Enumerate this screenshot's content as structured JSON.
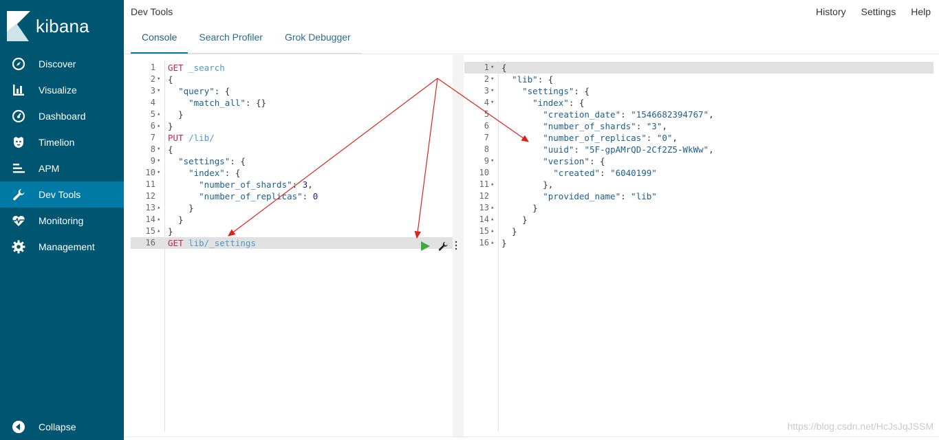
{
  "brand": {
    "logo_text": "kibana"
  },
  "sidebar": {
    "items": [
      {
        "label": "Discover",
        "icon": "compass-icon",
        "active": false
      },
      {
        "label": "Visualize",
        "icon": "bar-chart-icon",
        "active": false
      },
      {
        "label": "Dashboard",
        "icon": "dashboard-gauge-icon",
        "active": false
      },
      {
        "label": "Timelion",
        "icon": "timelion-icon",
        "active": false
      },
      {
        "label": "APM",
        "icon": "apm-icon",
        "active": false
      },
      {
        "label": "Dev Tools",
        "icon": "wrench-icon",
        "active": true
      },
      {
        "label": "Monitoring",
        "icon": "heartbeat-icon",
        "active": false
      },
      {
        "label": "Management",
        "icon": "gear-icon",
        "active": false
      }
    ],
    "collapse_label": "Collapse"
  },
  "header": {
    "title": "Dev Tools",
    "links": [
      "History",
      "Settings",
      "Help"
    ],
    "tabs": [
      {
        "label": "Console",
        "active": true
      },
      {
        "label": "Search Profiler",
        "active": false
      },
      {
        "label": "Grok Debugger",
        "active": false
      }
    ]
  },
  "request_editor": {
    "lines": [
      {
        "n": "1",
        "fold": "",
        "tokens": [
          [
            "m",
            "GET"
          ],
          [
            "t",
            " "
          ],
          [
            "u",
            "_search"
          ]
        ]
      },
      {
        "n": "2",
        "fold": "▾",
        "tokens": [
          [
            "t",
            "{"
          ]
        ]
      },
      {
        "n": "3",
        "fold": "▾",
        "tokens": [
          [
            "t",
            "  "
          ],
          [
            "k",
            "\"query\""
          ],
          [
            "t",
            ": {"
          ]
        ]
      },
      {
        "n": "4",
        "fold": "",
        "tokens": [
          [
            "t",
            "    "
          ],
          [
            "k",
            "\"match_all\""
          ],
          [
            "t",
            ": {}"
          ]
        ]
      },
      {
        "n": "5",
        "fold": "▴",
        "tokens": [
          [
            "t",
            "  }"
          ]
        ]
      },
      {
        "n": "6",
        "fold": "▴",
        "tokens": [
          [
            "t",
            "}"
          ]
        ]
      },
      {
        "n": "7",
        "fold": "",
        "tokens": [
          [
            "m",
            "PUT"
          ],
          [
            "t",
            " "
          ],
          [
            "u",
            "/lib/"
          ]
        ]
      },
      {
        "n": "8",
        "fold": "▾",
        "tokens": [
          [
            "t",
            "{"
          ]
        ]
      },
      {
        "n": "9",
        "fold": "▾",
        "tokens": [
          [
            "t",
            "  "
          ],
          [
            "k",
            "\"settings\""
          ],
          [
            "t",
            ": {"
          ]
        ]
      },
      {
        "n": "10",
        "fold": "▾",
        "tokens": [
          [
            "t",
            "    "
          ],
          [
            "k",
            "\"index\""
          ],
          [
            "t",
            ": {"
          ]
        ]
      },
      {
        "n": "11",
        "fold": "",
        "tokens": [
          [
            "t",
            "      "
          ],
          [
            "k",
            "\"number_of_shards\""
          ],
          [
            "t",
            ": "
          ],
          [
            "n",
            "3"
          ],
          [
            "t",
            ","
          ]
        ]
      },
      {
        "n": "12",
        "fold": "",
        "tokens": [
          [
            "t",
            "      "
          ],
          [
            "k",
            "\"number_of_replicas\""
          ],
          [
            "t",
            ": "
          ],
          [
            "n",
            "0"
          ]
        ]
      },
      {
        "n": "13",
        "fold": "▴",
        "tokens": [
          [
            "t",
            "    }"
          ]
        ]
      },
      {
        "n": "14",
        "fold": "▴",
        "tokens": [
          [
            "t",
            "  }"
          ]
        ]
      },
      {
        "n": "15",
        "fold": "▴",
        "tokens": [
          [
            "t",
            "}"
          ]
        ]
      },
      {
        "n": "16",
        "fold": "",
        "hl": true,
        "tokens": [
          [
            "m",
            "GET"
          ],
          [
            "t",
            " "
          ],
          [
            "u",
            "lib/_settings"
          ]
        ]
      }
    ]
  },
  "response_editor": {
    "lines": [
      {
        "n": "1",
        "fold": "▾",
        "hl": true,
        "tokens": [
          [
            "t",
            "{"
          ]
        ]
      },
      {
        "n": "2",
        "fold": "▾",
        "tokens": [
          [
            "t",
            "  "
          ],
          [
            "k",
            "\"lib\""
          ],
          [
            "t",
            ": {"
          ]
        ]
      },
      {
        "n": "3",
        "fold": "▾",
        "tokens": [
          [
            "t",
            "    "
          ],
          [
            "k",
            "\"settings\""
          ],
          [
            "t",
            ": {"
          ]
        ]
      },
      {
        "n": "4",
        "fold": "▾",
        "tokens": [
          [
            "t",
            "      "
          ],
          [
            "k",
            "\"index\""
          ],
          [
            "t",
            ": {"
          ]
        ]
      },
      {
        "n": "5",
        "fold": "",
        "tokens": [
          [
            "t",
            "        "
          ],
          [
            "k",
            "\"creation_date\""
          ],
          [
            "t",
            ": "
          ],
          [
            "s",
            "\"1546682394767\""
          ],
          [
            "t",
            ","
          ]
        ]
      },
      {
        "n": "6",
        "fold": "",
        "tokens": [
          [
            "t",
            "        "
          ],
          [
            "k",
            "\"number_of_shards\""
          ],
          [
            "t",
            ": "
          ],
          [
            "s",
            "\"3\""
          ],
          [
            "t",
            ","
          ]
        ]
      },
      {
        "n": "7",
        "fold": "",
        "tokens": [
          [
            "t",
            "        "
          ],
          [
            "k",
            "\"number_of_replicas\""
          ],
          [
            "t",
            ": "
          ],
          [
            "s",
            "\"0\""
          ],
          [
            "t",
            ","
          ]
        ]
      },
      {
        "n": "8",
        "fold": "",
        "tokens": [
          [
            "t",
            "        "
          ],
          [
            "k",
            "\"uuid\""
          ],
          [
            "t",
            ": "
          ],
          [
            "s",
            "\"5F-gpAMrQD-2Cf2Z5-WkWw\""
          ],
          [
            "t",
            ","
          ]
        ]
      },
      {
        "n": "9",
        "fold": "▾",
        "tokens": [
          [
            "t",
            "        "
          ],
          [
            "k",
            "\"version\""
          ],
          [
            "t",
            ": {"
          ]
        ]
      },
      {
        "n": "10",
        "fold": "",
        "tokens": [
          [
            "t",
            "          "
          ],
          [
            "k",
            "\"created\""
          ],
          [
            "t",
            ": "
          ],
          [
            "s",
            "\"6040199\""
          ]
        ]
      },
      {
        "n": "11",
        "fold": "▴",
        "tokens": [
          [
            "t",
            "        },"
          ]
        ]
      },
      {
        "n": "12",
        "fold": "",
        "tokens": [
          [
            "t",
            "        "
          ],
          [
            "k",
            "\"provided_name\""
          ],
          [
            "t",
            ": "
          ],
          [
            "s",
            "\"lib\""
          ]
        ]
      },
      {
        "n": "13",
        "fold": "▴",
        "tokens": [
          [
            "t",
            "      }"
          ]
        ]
      },
      {
        "n": "14",
        "fold": "▴",
        "tokens": [
          [
            "t",
            "    }"
          ]
        ]
      },
      {
        "n": "15",
        "fold": "▴",
        "tokens": [
          [
            "t",
            "  }"
          ]
        ]
      },
      {
        "n": "16",
        "fold": "▴",
        "tokens": [
          [
            "t",
            "}"
          ]
        ]
      }
    ]
  },
  "actions": {
    "run_icon": "play-icon",
    "settings_icon": "wrench-icon",
    "more_icon": "vertical-dots-icon"
  },
  "colors": {
    "sidebar_bg": "#005571",
    "sidebar_active": "#0079a5",
    "method": "#c7254e",
    "url": "#4a9bc7",
    "key": "#1c5d8f",
    "run": "#3caa3c",
    "annotation_arrow": "#e0201b"
  },
  "watermark": "https://blog.csdn.net/HcJsJqJSSM"
}
